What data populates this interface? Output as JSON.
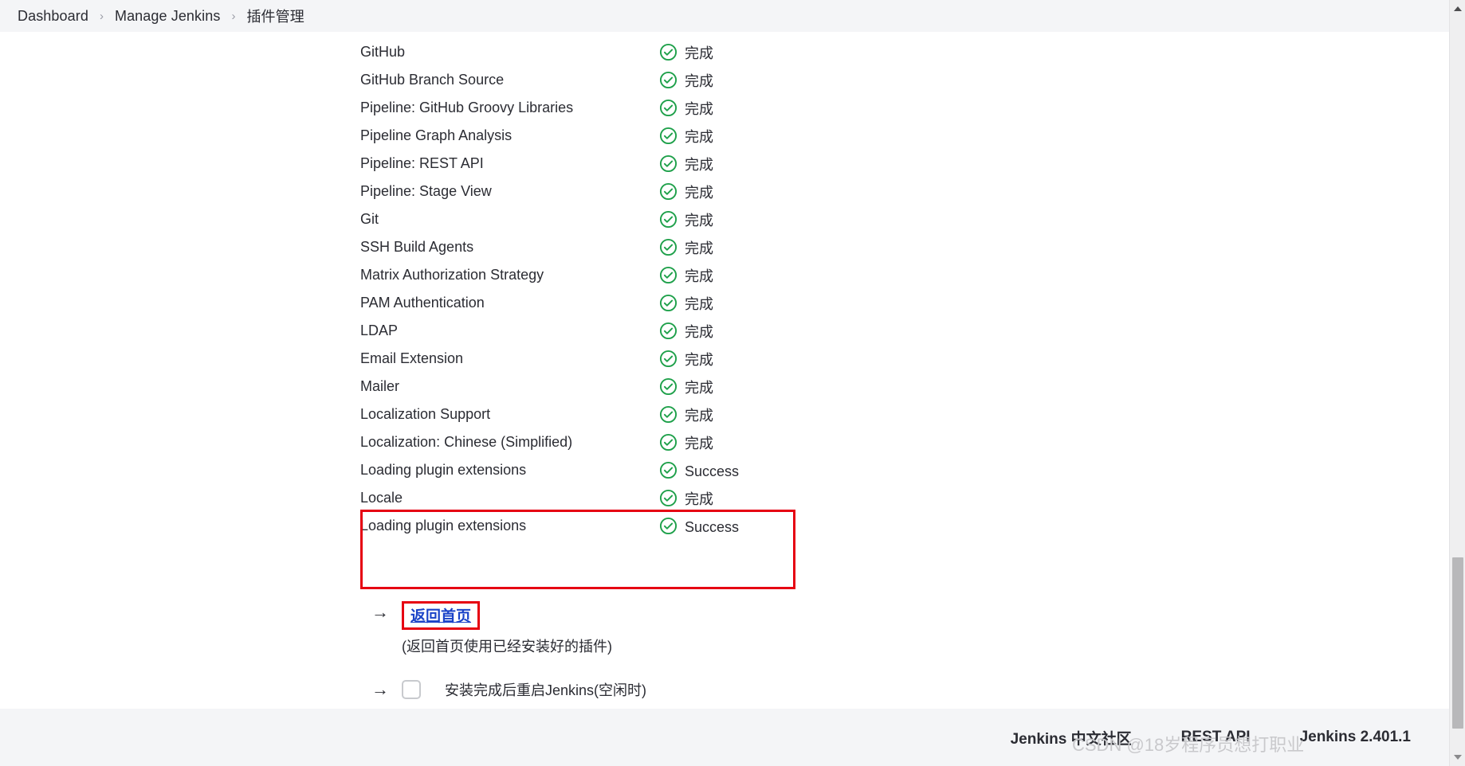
{
  "breadcrumb": {
    "items": [
      {
        "label": "Dashboard",
        "link": true
      },
      {
        "label": "Manage Jenkins",
        "link": true
      },
      {
        "label": "插件管理",
        "link": false
      }
    ],
    "separator": "›"
  },
  "install_progress": {
    "rows": [
      {
        "name": "GitHub",
        "status": "完成"
      },
      {
        "name": "GitHub Branch Source",
        "status": "完成"
      },
      {
        "name": "Pipeline: GitHub Groovy Libraries",
        "status": "完成"
      },
      {
        "name": "Pipeline Graph Analysis",
        "status": "完成"
      },
      {
        "name": "Pipeline: REST API",
        "status": "完成"
      },
      {
        "name": "Pipeline: Stage View",
        "status": "完成"
      },
      {
        "name": "Git",
        "status": "完成"
      },
      {
        "name": "SSH Build Agents",
        "status": "完成"
      },
      {
        "name": "Matrix Authorization Strategy",
        "status": "完成"
      },
      {
        "name": "PAM Authentication",
        "status": "完成"
      },
      {
        "name": "LDAP",
        "status": "完成"
      },
      {
        "name": "Email Extension",
        "status": "完成"
      },
      {
        "name": "Mailer",
        "status": "完成"
      },
      {
        "name": "Localization Support",
        "status": "完成"
      },
      {
        "name": "Localization: Chinese (Simplified)",
        "status": "完成"
      },
      {
        "name": "Loading plugin extensions",
        "status": "Success"
      },
      {
        "name": "Locale",
        "status": "完成"
      },
      {
        "name": "Loading plugin extensions",
        "status": "Success"
      }
    ],
    "status_icon": "check-circle-icon",
    "icon_color": "#1ea04a"
  },
  "annotations": {
    "color": "#e60012",
    "highlight_rows_label": "Locale / Loading plugin extensions"
  },
  "actions": {
    "arrow_glyph": "→",
    "home_link_label": "返回首页",
    "home_link_color": "#1a43c8",
    "home_note": "(返回首页使用已经安装好的插件)",
    "restart_label": "安装完成后重启Jenkins(空闲时)",
    "restart_checked": false
  },
  "footer": {
    "links": [
      {
        "label": "Jenkins 中文社区",
        "link": true
      },
      {
        "label": "REST API",
        "link": true
      },
      {
        "label": "Jenkins 2.401.1",
        "link": false
      }
    ]
  },
  "watermark": {
    "text": "CSDN @18岁程序员想打职业"
  },
  "scrollbar": {
    "up_arrow": "scroll-up-arrow-icon",
    "down_arrow": "scroll-down-arrow-icon"
  }
}
